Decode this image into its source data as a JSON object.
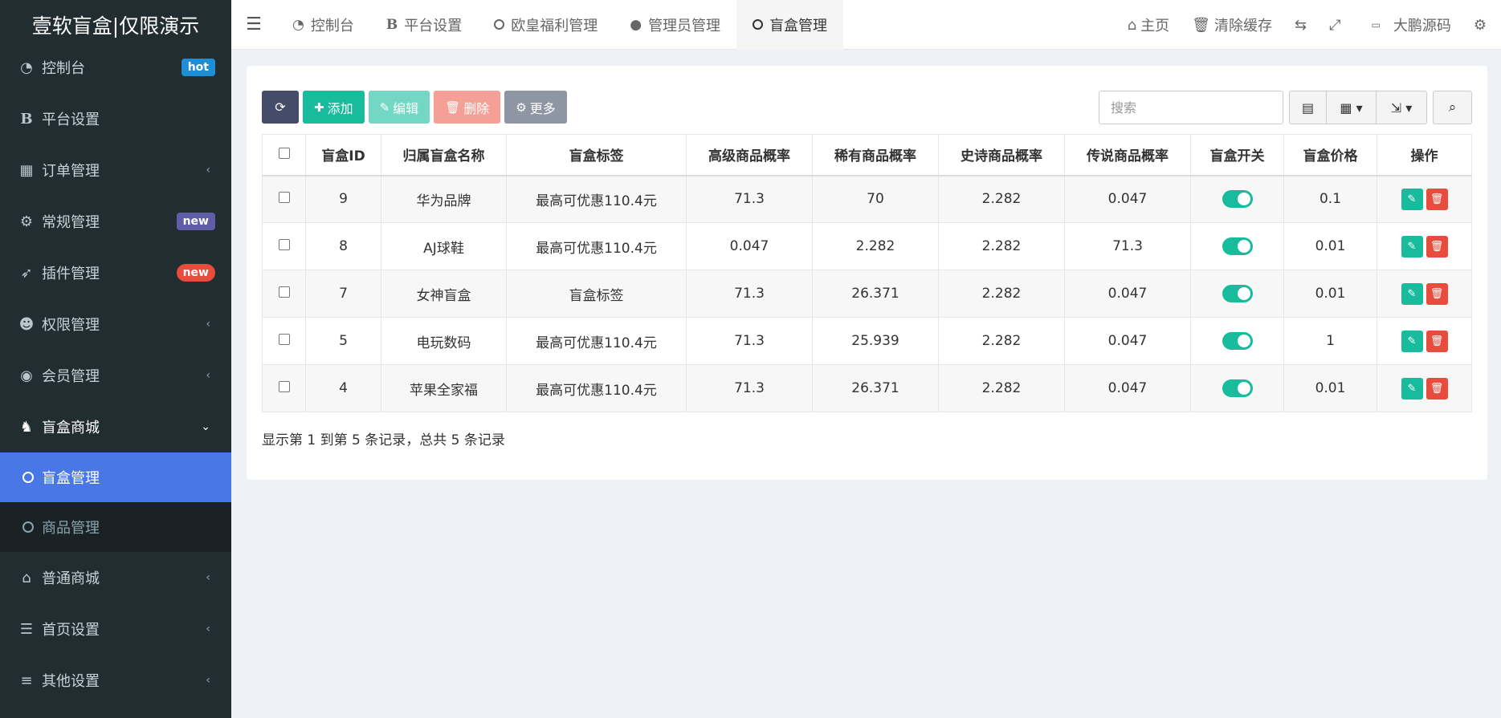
{
  "brand": "壹软盲盒|仅限演示",
  "sidebar": {
    "items": [
      {
        "label": "控制台",
        "icon": "dashboard-icon",
        "badge": "hot"
      },
      {
        "label": "平台设置",
        "icon": "bold-b-icon"
      },
      {
        "label": "订单管理",
        "icon": "table-icon"
      },
      {
        "label": "常规管理",
        "icon": "cogs-icon",
        "badge": "new"
      },
      {
        "label": "插件管理",
        "icon": "rocket-icon",
        "badge": "new"
      },
      {
        "label": "权限管理",
        "icon": "users-icon"
      },
      {
        "label": "会员管理",
        "icon": "user-circle-icon"
      },
      {
        "label": "盲盒商城",
        "icon": "blindbox-icon"
      },
      {
        "label": "普通商城",
        "icon": "bank-icon"
      },
      {
        "label": "首页设置",
        "icon": "list-icon"
      },
      {
        "label": "其他设置",
        "icon": "database-icon"
      }
    ],
    "subitems": [
      {
        "label": "盲盒管理",
        "active": true
      },
      {
        "label": "商品管理"
      }
    ]
  },
  "topnav": {
    "tabs": [
      {
        "label": "控制台",
        "icon": "dashboard-icon"
      },
      {
        "label": "平台设置",
        "icon": "bold-b-icon"
      },
      {
        "label": "欧皇福利管理",
        "icon": "circle-icon"
      },
      {
        "label": "管理员管理",
        "icon": "user-icon"
      },
      {
        "label": "盲盒管理",
        "icon": "circle-icon",
        "active": true
      }
    ],
    "right": {
      "home": "主页",
      "clear_cache": "清除缓存",
      "user": "大鹏源码"
    }
  },
  "toolbar": {
    "add": "添加",
    "edit": "编辑",
    "delete": "删除",
    "more": "更多",
    "search_placeholder": "搜索"
  },
  "table": {
    "headers": [
      "盲盒ID",
      "归属盲盒名称",
      "盲盒标签",
      "高级商品概率",
      "稀有商品概率",
      "史诗商品概率",
      "传说商品概率",
      "盲盒开关",
      "盲盒价格",
      "操作"
    ],
    "rows": [
      {
        "id": "9",
        "name": "华为品牌",
        "tag": "最高可优惠110.4元",
        "advanced": "71.3",
        "rare": "70",
        "epic": "2.282",
        "legend": "0.047",
        "switch": "on",
        "price": "0.1"
      },
      {
        "id": "8",
        "name": "AJ球鞋",
        "tag": "最高可优惠110.4元",
        "advanced": "0.047",
        "rare": "2.282",
        "epic": "2.282",
        "legend": "71.3",
        "switch": "on",
        "price": "0.01"
      },
      {
        "id": "7",
        "name": "女神盲盒",
        "tag": "盲盒标签",
        "advanced": "71.3",
        "rare": "26.371",
        "epic": "2.282",
        "legend": "0.047",
        "switch": "on",
        "price": "0.01"
      },
      {
        "id": "5",
        "name": "电玩数码",
        "tag": "最高可优惠110.4元",
        "advanced": "71.3",
        "rare": "25.939",
        "epic": "2.282",
        "legend": "0.047",
        "switch": "on",
        "price": "1"
      },
      {
        "id": "4",
        "name": "苹果全家福",
        "tag": "最高可优惠110.4元",
        "advanced": "71.3",
        "rare": "26.371",
        "epic": "2.282",
        "legend": "0.047",
        "switch": "on",
        "price": "0.01"
      }
    ]
  },
  "pager_info": "显示第 1 到第 5 条记录，总共 5 条记录",
  "colors": {
    "sidebar_bg": "#222d32",
    "active_sub": "#4a77e6",
    "success": "#18bc9c",
    "danger": "#e74c3c"
  }
}
